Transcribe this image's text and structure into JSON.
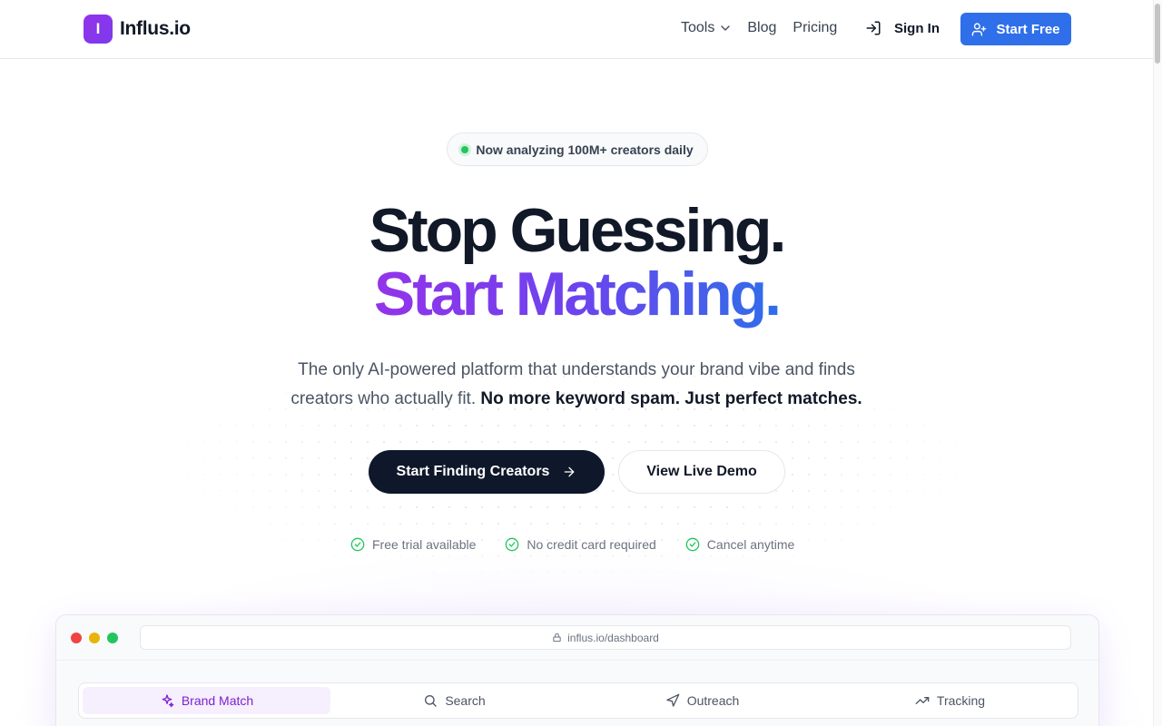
{
  "brand": {
    "logo_letter": "I",
    "name": "Influs.io"
  },
  "nav": {
    "links": [
      {
        "label": "Tools",
        "has_dropdown": true
      },
      {
        "label": "Blog"
      },
      {
        "label": "Pricing"
      }
    ],
    "sign_in": "Sign In",
    "start_free": "Start Free"
  },
  "hero": {
    "badge": "Now analyzing 100M+ creators daily",
    "headline_line1": "Stop Guessing.",
    "headline_line2": "Start Matching.",
    "subtext": "The only AI-powered platform that understands your brand vibe and finds creators who actually fit.",
    "subtext_bold": "No more keyword spam. Just perfect matches.",
    "primary_cta": "Start Finding Creators",
    "secondary_cta": "View Live Demo",
    "benefits": [
      "Free trial available",
      "No credit card required",
      "Cancel anytime"
    ]
  },
  "dashboard": {
    "url": "influs.io/dashboard",
    "tabs": [
      {
        "label": "Brand Match",
        "icon": "sparkles-icon",
        "active": true
      },
      {
        "label": "Search",
        "icon": "search-icon",
        "active": false
      },
      {
        "label": "Outreach",
        "icon": "send-icon",
        "active": false
      },
      {
        "label": "Tracking",
        "icon": "trending-up-icon",
        "active": false
      }
    ]
  },
  "colors": {
    "accent_blue": "#2f6fe9",
    "accent_purple": "#9333ea",
    "dark": "#0f172a",
    "success": "#22c55e"
  }
}
